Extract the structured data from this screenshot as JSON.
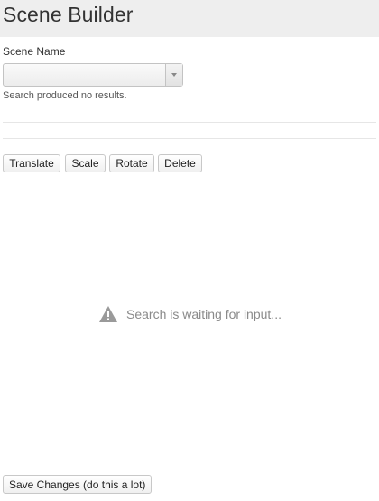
{
  "header": {
    "title": "Scene Builder"
  },
  "scene_field": {
    "label": "Scene Name",
    "value": "",
    "message": "Search produced no results."
  },
  "toolbar": {
    "translate_label": "Translate",
    "scale_label": "Scale",
    "rotate_label": "Rotate",
    "delete_label": "Delete"
  },
  "status": {
    "icon": "warning-icon",
    "message": "Search is waiting for input..."
  },
  "footer": {
    "save_label": "Save Changes (do this a lot)"
  },
  "colors": {
    "header_bg": "#eeeeee",
    "status_text": "#8a8a8a",
    "warning_icon": "#9a9a9a"
  }
}
